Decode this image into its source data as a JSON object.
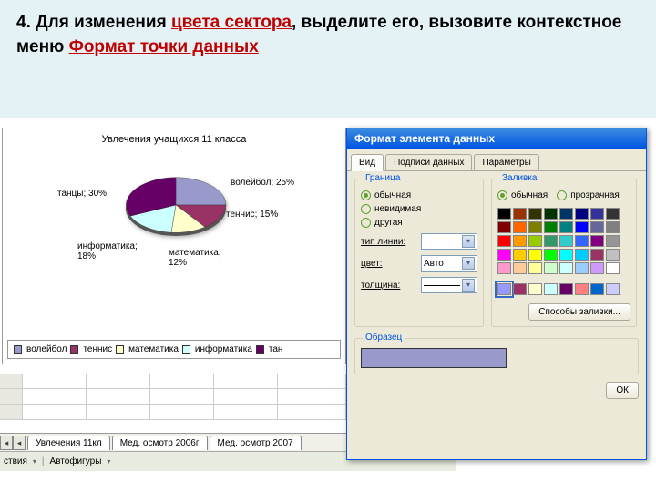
{
  "instruction": {
    "prefix": "4. Для изменения ",
    "hl1": "цвета сектора",
    "mid": ", выделите его, вызовите контекстное меню ",
    "hl2": "Формат точки данных"
  },
  "chart_data": {
    "type": "pie",
    "title": "Увлечения учащихся 11 класса",
    "series": [
      {
        "name": "волейбол",
        "value": 25,
        "color": "#9999cc"
      },
      {
        "name": "теннис",
        "value": 15,
        "color": "#993366"
      },
      {
        "name": "математика",
        "value": 12,
        "color": "#ffffcc"
      },
      {
        "name": "информатика",
        "value": 18,
        "color": "#ccffff"
      },
      {
        "name": "танцы",
        "value": 30,
        "color": "#660066"
      }
    ],
    "data_labels": {
      "volleyball": "волейбол; 25%",
      "tennis": "теннис; 15%",
      "math": "математика; 12%",
      "informatics": "информатика; 18%",
      "dance": "танцы; 30%"
    },
    "legend": [
      "волейбол",
      "теннис",
      "математика",
      "информатика",
      "тан"
    ]
  },
  "sheet_tabs": {
    "nav_prev_all": "◂◂",
    "nav_prev": "◂",
    "tab1": "Увлечения 11кл",
    "tab2": "Мед. осмотр 2006г",
    "tab3": "Мед. осмотр 2007"
  },
  "toolbar": {
    "actions": "ствия",
    "autoshapes": "Автофигуры"
  },
  "dialog": {
    "title": "Формат элемента данных",
    "tabs": {
      "view": "Вид",
      "labels": "Подписи данных",
      "params": "Параметры"
    },
    "border_group": "Граница",
    "border_opts": {
      "normal": "обычная",
      "invisible": "невидимая",
      "other": "другая"
    },
    "line_type": "тип линии:",
    "color": "цвет:",
    "color_auto": "Авто",
    "thickness": "толщина:",
    "fill_group": "Заливка",
    "fill_opts": {
      "normal": "обычная",
      "transparent": "прозрачная"
    },
    "fill_methods": "Способы заливки...",
    "sample": "Образец",
    "ok": "ОК"
  },
  "palette_colors": [
    "#000000",
    "#993300",
    "#333300",
    "#003300",
    "#003366",
    "#000080",
    "#333399",
    "#333333",
    "#800000",
    "#ff6600",
    "#808000",
    "#008000",
    "#008080",
    "#0000ff",
    "#666699",
    "#808080",
    "#ff0000",
    "#ff9900",
    "#99cc00",
    "#339966",
    "#33cccc",
    "#3366ff",
    "#800080",
    "#969696",
    "#ff00ff",
    "#ffcc00",
    "#ffff00",
    "#00ff00",
    "#00ffff",
    "#00ccff",
    "#993366",
    "#c0c0c0",
    "#ff99cc",
    "#ffcc99",
    "#ffff99",
    "#ccffcc",
    "#ccffff",
    "#99ccff",
    "#cc99ff",
    "#ffffff"
  ],
  "palette_colors2": [
    "#9999ff",
    "#993366",
    "#ffffcc",
    "#ccffff",
    "#660066",
    "#ff8080",
    "#0066cc",
    "#ccccff"
  ]
}
